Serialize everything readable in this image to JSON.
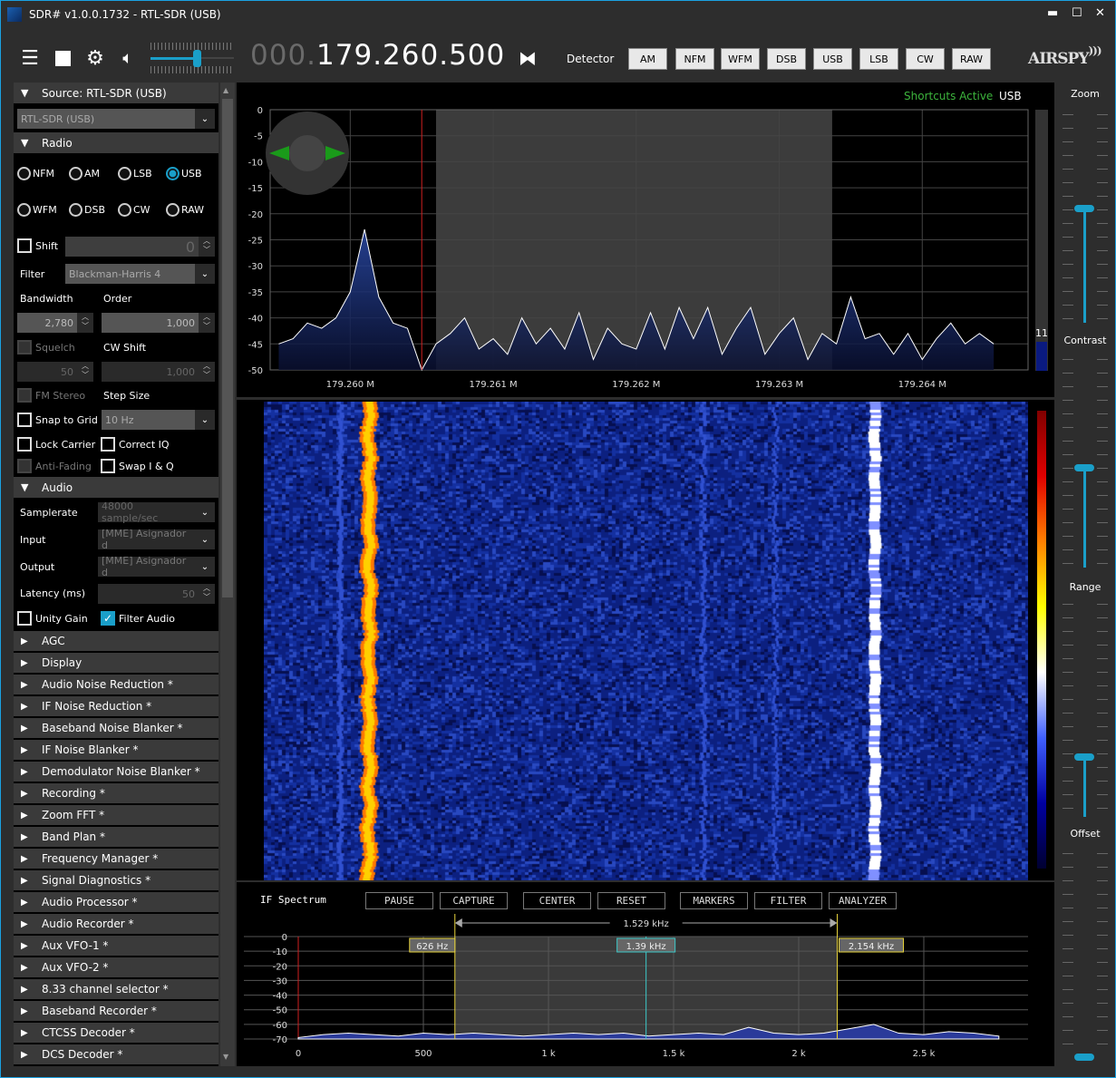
{
  "window": {
    "title": "SDR# v1.0.0.1732 - RTL-SDR (USB)",
    "minimize": "▬",
    "maximize": "☐",
    "close": "✕"
  },
  "toolbar": {
    "menu_icon": "hamburger-icon",
    "stop_icon": "stop-icon",
    "settings_icon": "gear-icon",
    "volume_icon": "speaker-icon",
    "volume": 0.55,
    "freq_dim": "000.",
    "freq": "179.260.500",
    "swap_icon": "swap-icon",
    "detector_label": "Detector",
    "modes": [
      "AM",
      "NFM",
      "WFM",
      "DSB",
      "USB",
      "LSB",
      "CW",
      "RAW"
    ],
    "logo": "AIRSPY"
  },
  "accent": "#1a9fc9",
  "left": {
    "source": {
      "header": "Source: RTL-SDR (USB)",
      "device": "RTL-SDR (USB)"
    },
    "radio": {
      "header": "Radio",
      "modes": [
        "NFM",
        "AM",
        "LSB",
        "USB",
        "WFM",
        "DSB",
        "CW",
        "RAW"
      ],
      "selected": "USB",
      "shift_label": "Shift",
      "shift_value": "0",
      "filter_label": "Filter",
      "filter_value": "Blackman-Harris 4",
      "bandwidth_label": "Bandwidth",
      "bandwidth_value": "2,780",
      "order_label": "Order",
      "order_value": "1,000",
      "squelch_label": "Squelch",
      "squelch_value": "50",
      "cwshift_label": "CW Shift",
      "cwshift_value": "1,000",
      "fmstereo_label": "FM Stereo",
      "stepsize_label": "Step Size",
      "snap_label": "Snap to Grid",
      "step_value": "10 Hz",
      "lockcarrier_label": "Lock Carrier",
      "correctiq_label": "Correct IQ",
      "antifading_label": "Anti-Fading",
      "swapiq_label": "Swap I & Q"
    },
    "audio": {
      "header": "Audio",
      "samplerate_label": "Samplerate",
      "samplerate_value": "48000 sample/sec",
      "input_label": "Input",
      "input_value": "[MME] Asignador d",
      "output_label": "Output",
      "output_value": "[MME] Asignador d",
      "latency_label": "Latency (ms)",
      "latency_value": "50",
      "unity_label": "Unity Gain",
      "filter_audio_label": "Filter Audio",
      "filter_audio_checked": true
    },
    "panels": [
      "AGC",
      "Display",
      "Audio Noise Reduction *",
      "IF Noise Reduction *",
      "Baseband Noise Blanker *",
      "IF Noise Blanker *",
      "Demodulator Noise Blanker *",
      "Recording *",
      "Zoom FFT *",
      "Band Plan *",
      "Frequency Manager *",
      "Signal Diagnostics *",
      "Audio Processor *",
      "Audio Recorder *",
      "Aux VFO-1 *",
      "Aux VFO-2 *",
      "8.33 channel selector *",
      "Baseband Recorder *",
      "CTCSS Decoder *",
      "DCS Decoder *"
    ]
  },
  "spectrum": {
    "shortcuts": "Shortcuts Active",
    "mode": "USB",
    "level_value": "11"
  },
  "chart_data": [
    {
      "type": "area",
      "title": "",
      "xlabel": "",
      "ylabel": "",
      "grid": true,
      "yticks": [
        0,
        -5,
        -10,
        -15,
        -20,
        -25,
        -30,
        -35,
        -40,
        -45,
        -50
      ],
      "ylim": [
        -50,
        0
      ],
      "xticks": [
        "179.260 M",
        "179.261 M",
        "179.262 M",
        "179.263 M",
        "179.264 M"
      ],
      "xtick_values": [
        179.26,
        179.261,
        179.262,
        179.263,
        179.264
      ],
      "xlim": [
        179.25944,
        179.26474
      ],
      "vfo_frequency": 179.2605,
      "filter_band": [
        179.2606,
        179.26337
      ],
      "x": [
        179.2595,
        179.2596,
        179.2597,
        179.2598,
        179.2599,
        179.26,
        179.2601,
        179.2602,
        179.2603,
        179.2604,
        179.2605,
        179.2606,
        179.2607,
        179.2608,
        179.2609,
        179.261,
        179.2611,
        179.2612,
        179.2613,
        179.2614,
        179.2615,
        179.2616,
        179.2617,
        179.2618,
        179.2619,
        179.262,
        179.2621,
        179.2622,
        179.2623,
        179.2624,
        179.2625,
        179.2626,
        179.2627,
        179.2628,
        179.2629,
        179.263,
        179.2631,
        179.2632,
        179.2633,
        179.2634,
        179.2635,
        179.2636,
        179.2637,
        179.2638,
        179.2639,
        179.264,
        179.2641,
        179.2642,
        179.2643,
        179.2644,
        179.2645
      ],
      "y": [
        -45,
        -44,
        -41,
        -42,
        -40,
        -35,
        -23,
        -36,
        -41,
        -42,
        -50,
        -45,
        -43,
        -40,
        -46,
        -44,
        -47,
        -40,
        -45,
        -42,
        -46,
        -39,
        -48,
        -42,
        -45,
        -46,
        -39,
        -46,
        -38,
        -44,
        -38,
        -47,
        -42,
        -38,
        -47,
        -43,
        -40,
        -48,
        -43,
        -45,
        -36,
        -44,
        -43,
        -47,
        -43,
        -48,
        -44,
        -41,
        -45,
        -43,
        -45
      ]
    },
    {
      "type": "line",
      "title": "IF Spectrum",
      "xlabel": "",
      "ylabel": "",
      "yticks": [
        0,
        -10,
        -20,
        -30,
        -40,
        -50,
        -60,
        -70
      ],
      "ylim": [
        -70,
        0
      ],
      "xticks": [
        "0",
        "500",
        "1 k",
        "1.5 k",
        "2 k",
        "2.5 k"
      ],
      "xtick_values": [
        0,
        500,
        1000,
        1500,
        2000,
        2500
      ],
      "xlim": [
        0,
        2920
      ],
      "markers": [
        {
          "label": "626 Hz",
          "value": 626,
          "color": "#e6d23c"
        },
        {
          "label": "1.39 kHz",
          "value": 1390,
          "color": "#3cc8c8"
        },
        {
          "label": "2.154 kHz",
          "value": 2154,
          "color": "#e6d23c"
        }
      ],
      "span_label": "1.529 kHz",
      "x": [
        0,
        100,
        200,
        300,
        400,
        500,
        600,
        700,
        800,
        900,
        1000,
        1100,
        1200,
        1300,
        1400,
        1500,
        1600,
        1700,
        1800,
        1900,
        2000,
        2100,
        2200,
        2300,
        2400,
        2500,
        2600,
        2700,
        2800
      ],
      "y": [
        -69,
        -67,
        -66,
        -67,
        -68,
        -66,
        -67,
        -66,
        -67,
        -68,
        -67,
        -66,
        -67,
        -66,
        -68,
        -67,
        -66,
        -67,
        -62,
        -66,
        -67,
        -66,
        -63,
        -60,
        -66,
        -67,
        -65,
        -66,
        -68
      ]
    }
  ],
  "if_spectrum": {
    "buttons": [
      "PAUSE",
      "CAPTURE",
      "CENTER",
      "RESET",
      "MARKERS",
      "FILTER",
      "ANALYZER"
    ]
  },
  "sliders": [
    {
      "label": "Zoom",
      "value": 0.55
    },
    {
      "label": "Contrast",
      "value": 0.48
    },
    {
      "label": "Range",
      "value": 0.28
    },
    {
      "label": "Offset",
      "value": 0.0
    }
  ]
}
